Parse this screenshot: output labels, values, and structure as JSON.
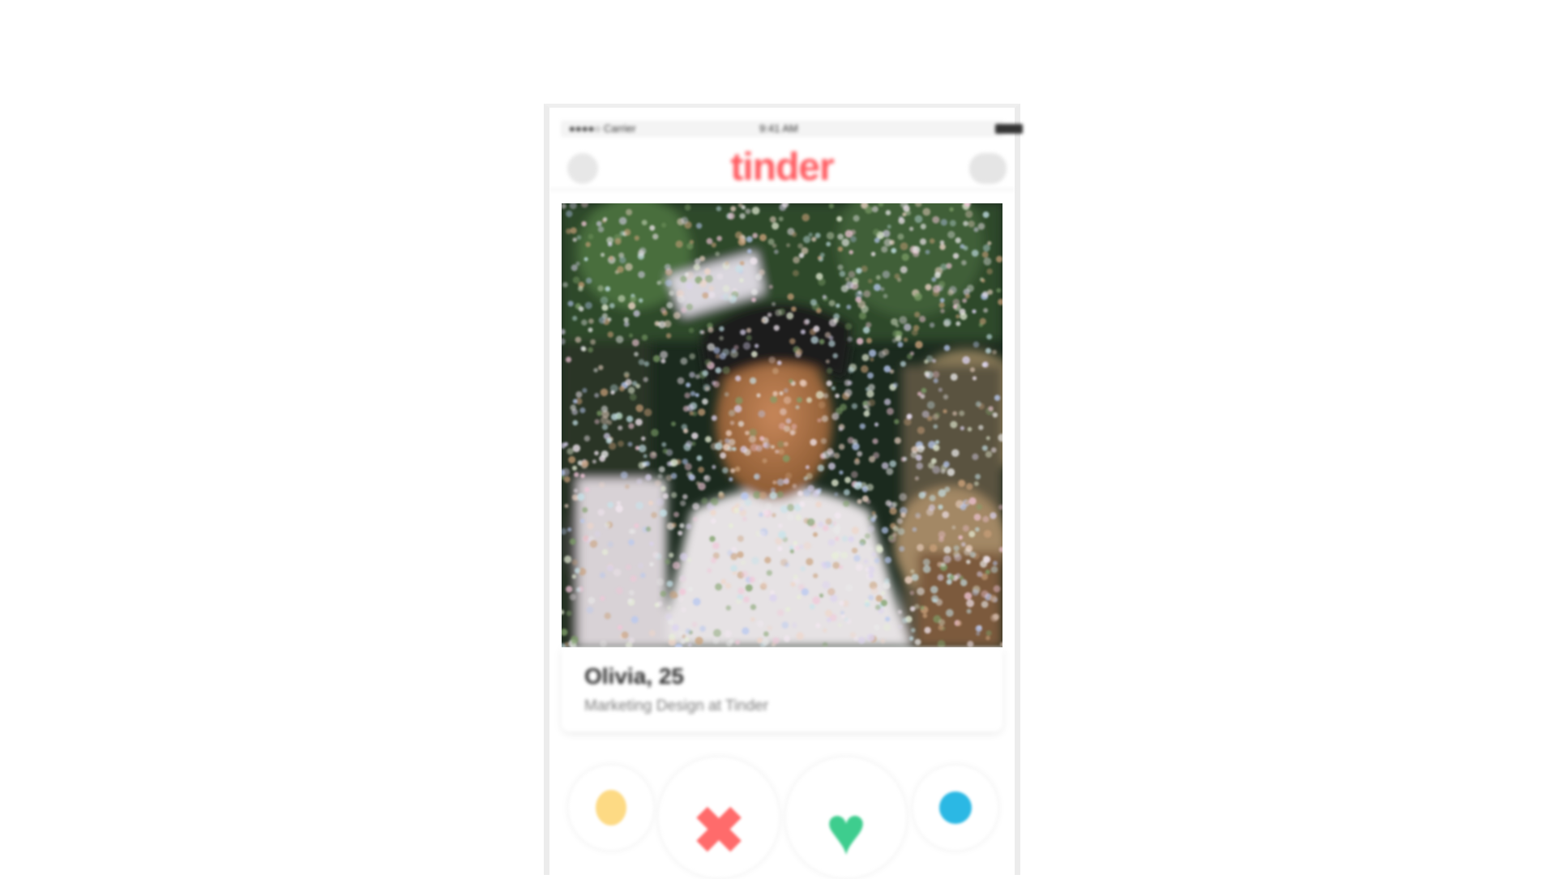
{
  "app": {
    "logo": "tinder",
    "brand_color": "#ff5a5f"
  },
  "status_bar": {
    "carrier": "●●●●○ Carrier",
    "time": "9:41 AM",
    "battery": "100%"
  },
  "nav": {
    "left_icon": "profile-icon",
    "right_icon": "chat-icon"
  },
  "profile": {
    "name_age": "Olivia, 25",
    "job": "Marketing Design at Tinder",
    "photo": "profile-photo"
  },
  "actions": {
    "undo": {
      "icon": "undo-icon",
      "color": "#fdda84"
    },
    "nope": {
      "icon": "x-icon",
      "glyph": "✖",
      "color": "#ff6b6b"
    },
    "like": {
      "icon": "heart-icon",
      "glyph": "♥",
      "color": "#3ecd8e"
    },
    "super_like": {
      "icon": "star-icon",
      "color": "#2bb8e4"
    }
  }
}
